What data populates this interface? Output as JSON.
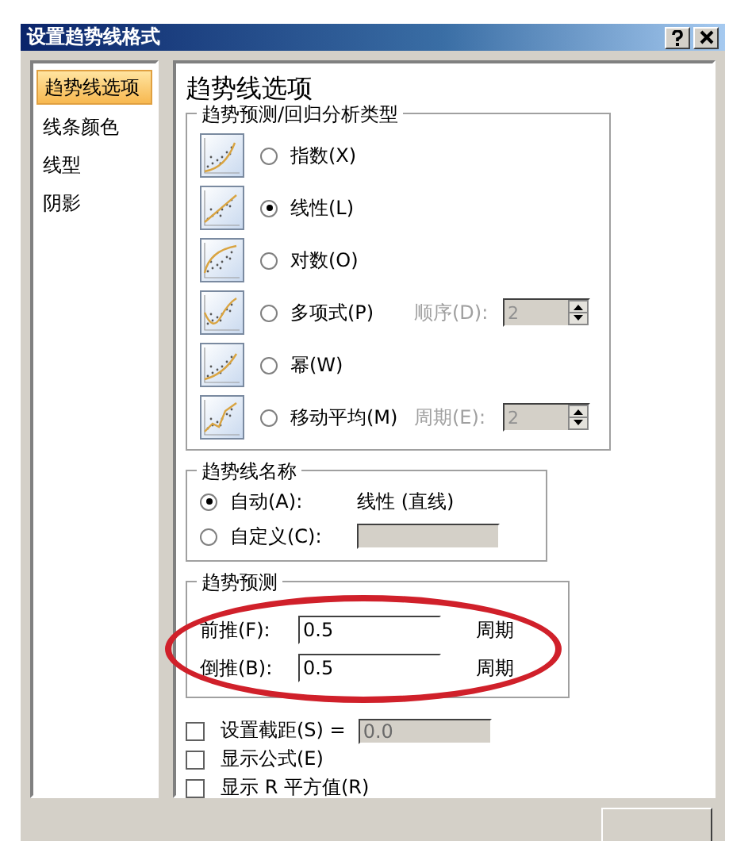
{
  "window": {
    "title": "设置趋势线格式"
  },
  "sidebar": {
    "items": [
      {
        "label": "趋势线选项",
        "selected": true
      },
      {
        "label": "线条颜色",
        "selected": false
      },
      {
        "label": "线型",
        "selected": false
      },
      {
        "label": "阴影",
        "selected": false
      }
    ]
  },
  "panel": {
    "heading": "趋势线选项",
    "type_group": {
      "title": "趋势预测/回归分析类型",
      "options": [
        {
          "kind": "exponential",
          "label": "指数(X)",
          "selected": false
        },
        {
          "kind": "linear",
          "label": "线性(L)",
          "selected": true
        },
        {
          "kind": "logarithmic",
          "label": "对数(O)",
          "selected": false
        },
        {
          "kind": "polynomial",
          "label": "多项式(P)",
          "selected": false,
          "param": {
            "label": "顺序(D):",
            "value": "2",
            "disabled": true
          }
        },
        {
          "kind": "power",
          "label": "幂(W)",
          "selected": false
        },
        {
          "kind": "moving_average",
          "label": "移动平均(M)",
          "selected": false,
          "param": {
            "label": "周期(E):",
            "value": "2",
            "disabled": true
          }
        }
      ]
    },
    "name_group": {
      "title": "趋势线名称",
      "options": [
        {
          "kind": "auto",
          "label": "自动(A):",
          "selected": true,
          "value": "线性 (直线)"
        },
        {
          "kind": "custom",
          "label": "自定义(C):",
          "selected": false,
          "disabled": true
        }
      ]
    },
    "forecast_group": {
      "title": "趋势预测",
      "rows": [
        {
          "label": "前推(F):",
          "value": "0.5",
          "unit": "周期"
        },
        {
          "label": "倒推(B):",
          "value": "0.5",
          "unit": "周期"
        }
      ]
    },
    "checkboxes": [
      {
        "label": "设置截距(S) =",
        "checked": false,
        "field": {
          "value": "0.0",
          "disabled": true
        }
      },
      {
        "label": "显示公式(E)",
        "checked": false
      },
      {
        "label": "显示 R 平方值(R)",
        "checked": false
      }
    ]
  },
  "annotations": [
    {
      "kind": "ellipse"
    }
  ]
}
